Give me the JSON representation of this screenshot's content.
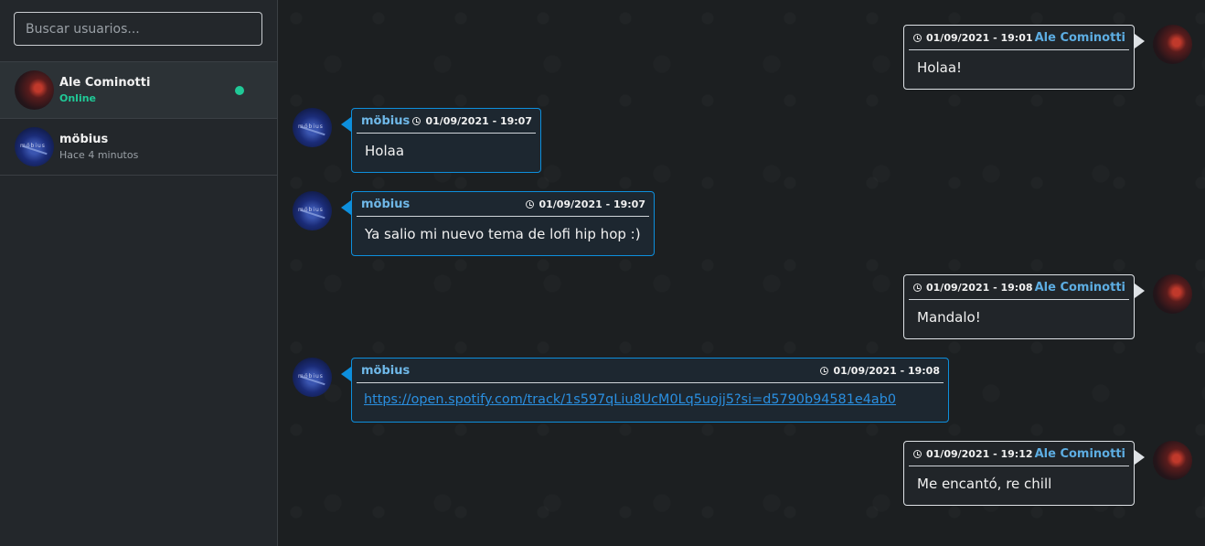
{
  "search": {
    "placeholder": "Buscar usuarios..."
  },
  "contacts": [
    {
      "name": "Ale Cominotti",
      "status": "Online",
      "online": true
    },
    {
      "name": "möbius",
      "status": "Hace 4 minutos",
      "online": false
    }
  ],
  "messages": [
    {
      "direction": "out",
      "sender": "Ale Cominotti",
      "time": "01/09/2021 - 19:01",
      "text": "Holaa!"
    },
    {
      "direction": "in",
      "sender": "möbius",
      "time": "01/09/2021 - 19:07",
      "text": "Holaa"
    },
    {
      "direction": "in",
      "sender": "möbius",
      "time": "01/09/2021 - 19:07",
      "text": "Ya salio mi nuevo tema de lofi hip hop :)"
    },
    {
      "direction": "out",
      "sender": "Ale Cominotti",
      "time": "01/09/2021 - 19:08",
      "text": "Mandalo!"
    },
    {
      "direction": "in",
      "sender": "möbius",
      "time": "01/09/2021 - 19:08",
      "text": "https://open.spotify.com/track/1s597qLiu8UcM0Lq5uojj5?si=d5790b94581e4ab0",
      "is_link": true
    },
    {
      "direction": "out",
      "sender": "Ale Cominotti",
      "time": "01/09/2021 - 19:12",
      "text": "Me encantó, re chill"
    }
  ],
  "colors": {
    "accent_in": "#0d8fdd",
    "online": "#20c997",
    "link": "#2a8fe0"
  },
  "icons": {
    "clock": "clock-icon"
  }
}
